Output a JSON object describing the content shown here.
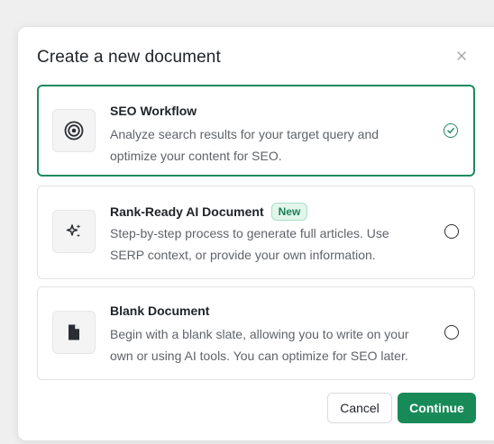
{
  "dialog": {
    "title": "Create a new document",
    "close_icon": "close-icon"
  },
  "options": [
    {
      "title": "SEO Workflow",
      "description": "Analyze search results for your target query and optimize your content for SEO.",
      "icon": "target-icon",
      "selected": true
    },
    {
      "title": "Rank-Ready AI Document",
      "badge": "New",
      "description": "Step-by-step process to generate full articles. Use SERP context, or provide your own information.",
      "icon": "sparkles-icon",
      "selected": false
    },
    {
      "title": "Blank Document",
      "description": "Begin with a blank slate, allowing you to write on your own or using AI tools. You can optimize for SEO later.",
      "icon": "document-icon",
      "selected": false
    }
  ],
  "footer": {
    "cancel_label": "Cancel",
    "continue_label": "Continue"
  },
  "colors": {
    "accent": "#1e8a5e",
    "badge_bg": "#e3f6ec"
  }
}
